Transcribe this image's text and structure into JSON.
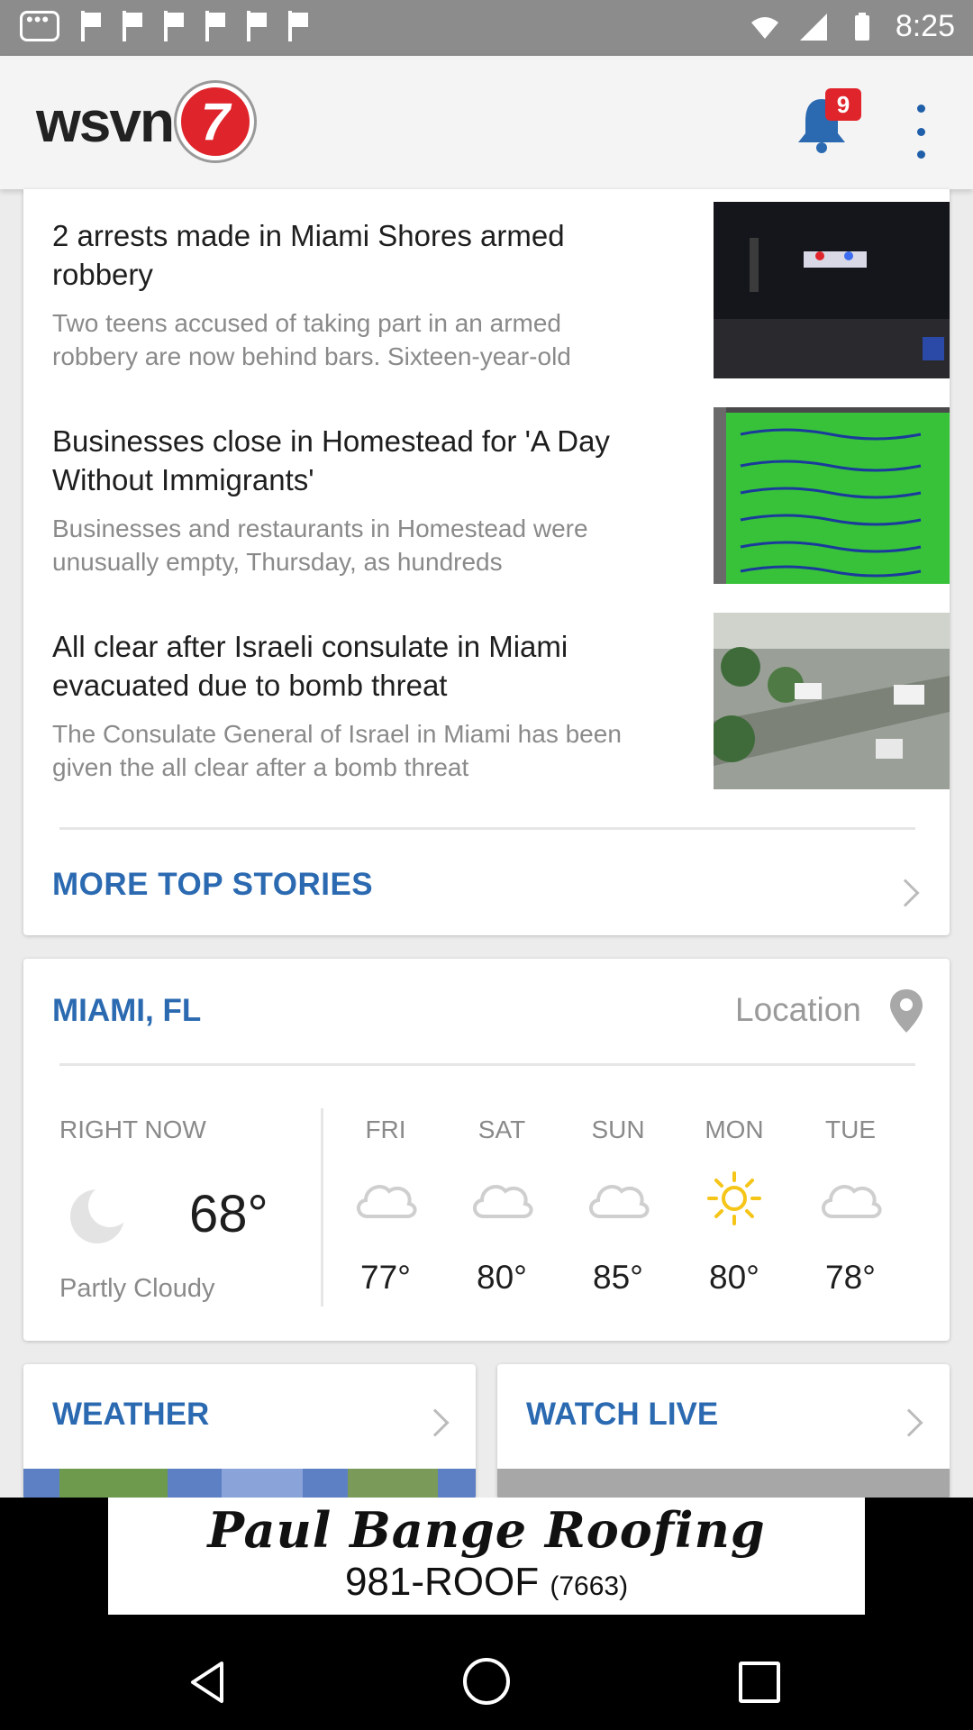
{
  "status_bar": {
    "time": "8:25"
  },
  "header": {
    "logo_text": "wsvn",
    "logo_number": "7",
    "notification_count": "9"
  },
  "stories": [
    {
      "headline": "2 arrests made in Miami Shores armed robbery",
      "summary": "Two teens accused of taking part in an armed robbery are now behind bars. Sixteen-year-old"
    },
    {
      "headline": "Businesses close in Homestead for 'A Day Without Immigrants'",
      "summary": "Businesses and restaurants in Homestead were unusually empty, Thursday, as hundreds"
    },
    {
      "headline": "All clear after Israeli consulate in Miami evacuated due to bomb threat",
      "summary": "The Consulate General of Israel in Miami has been given the all clear after a bomb threat"
    }
  ],
  "more_stories_label": "MORE TOP STORIES",
  "weather": {
    "city": "MIAMI, FL",
    "location_label": "Location",
    "now_label": "RIGHT NOW",
    "now_temp": "68°",
    "now_condition": "Partly Cloudy",
    "now_icon": "moon-partly-cloudy-icon",
    "forecast": [
      {
        "day": "FRI",
        "icon": "cloud-icon",
        "temp": "77°"
      },
      {
        "day": "SAT",
        "icon": "cloud-icon",
        "temp": "80°"
      },
      {
        "day": "SUN",
        "icon": "cloud-icon",
        "temp": "85°"
      },
      {
        "day": "MON",
        "icon": "sun-icon",
        "temp": "80°"
      },
      {
        "day": "TUE",
        "icon": "cloud-icon",
        "temp": "78°"
      }
    ]
  },
  "tiles": {
    "weather_label": "WEATHER",
    "watch_live_label": "WATCH LIVE"
  },
  "ad": {
    "line1": "Paul Bange Roofing",
    "line2": "981-ROOF",
    "line2_small": "(7663)"
  },
  "colors": {
    "accent_blue": "#2b6ab1",
    "brand_red": "#e0242b",
    "sun_yellow": "#f5c518"
  }
}
